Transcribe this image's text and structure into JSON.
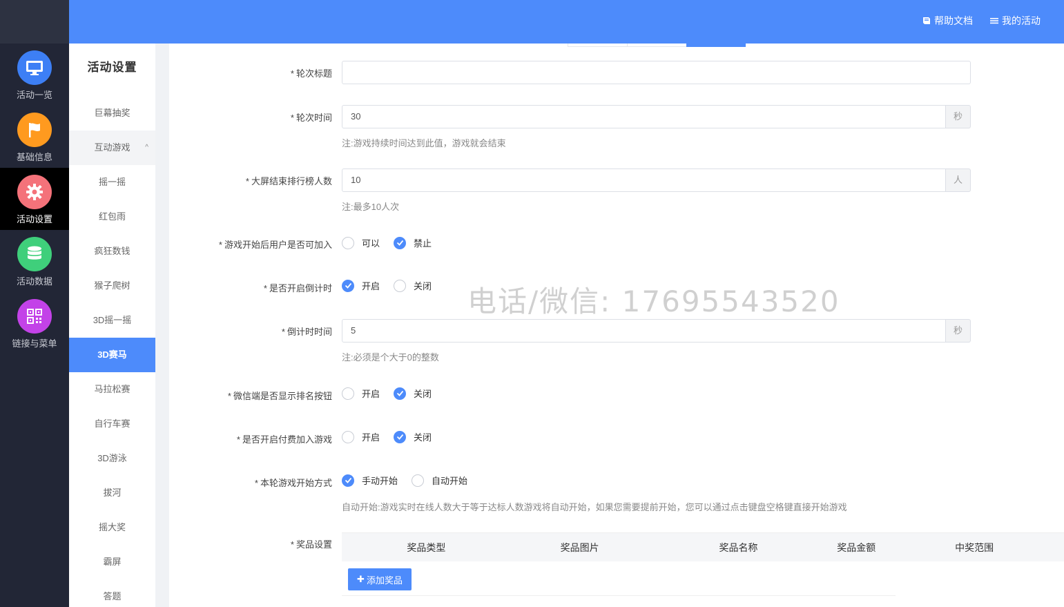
{
  "rail": {
    "items": [
      {
        "label": "活动一览",
        "icon": "monitor-icon",
        "color": "#3d7ff5"
      },
      {
        "label": "基础信息",
        "icon": "flag-icon",
        "color": "#ff9a1f"
      },
      {
        "label": "活动设置",
        "icon": "gear-icon",
        "color": "#f4727a"
      },
      {
        "label": "活动数据",
        "icon": "database-icon",
        "color": "#3fcf7b"
      },
      {
        "label": "链接与菜单",
        "icon": "qrcode-icon",
        "color": "#c342e8"
      }
    ],
    "active_index": 2
  },
  "header": {
    "help_label": "帮助文档",
    "help_icon": "book-icon",
    "activity_label": "我的活动",
    "activity_icon": "list-icon",
    "background": "#4d8bfb"
  },
  "submenu": {
    "title": "活动设置",
    "items": [
      "巨幕抽奖",
      "互动游戏",
      "摇一摇",
      "红包雨",
      "疯狂数钱",
      "猴子爬树",
      "3D摇一摇",
      "3D赛马",
      "马拉松赛",
      "自行车赛",
      "3D游泳",
      "拔河",
      "摇大奖",
      "霸屏",
      "答题"
    ],
    "group_caret": "^",
    "active_item": "3D赛马"
  },
  "form": {
    "round_title": {
      "label": "轮次标题",
      "value": ""
    },
    "round_time": {
      "label": "轮次时间",
      "value": "30",
      "unit": "秒",
      "hint": "注:游戏持续时间达到此值，游戏就会结束"
    },
    "rank_count": {
      "label": "大屏结束排行榜人数",
      "value": "10",
      "unit": "人",
      "hint": "注:最多10人次"
    },
    "join_after_start": {
      "label": "游戏开始后用户是否可加入",
      "options": [
        "可以",
        "禁止"
      ],
      "selected": "禁止"
    },
    "countdown_enabled": {
      "label": "是否开启倒计时",
      "options": [
        "开启",
        "关闭"
      ],
      "selected": "开启"
    },
    "countdown_time": {
      "label": "倒计时时间",
      "value": "5",
      "unit": "秒",
      "hint": "注:必须是个大于0的整数"
    },
    "show_rank_button": {
      "label": "微信端是否显示排名按钮",
      "options": [
        "开启",
        "关闭"
      ],
      "selected": "关闭"
    },
    "paid_join": {
      "label": "是否开启付费加入游戏",
      "options": [
        "开启",
        "关闭"
      ],
      "selected": "关闭"
    },
    "start_mode": {
      "label": "本轮游戏开始方式",
      "options": [
        "手动开始",
        "自动开始"
      ],
      "selected": "手动开始",
      "hint": "自动开始:游戏实时在线人数大于等于达标人数游戏将自动开始，如果您需要提前开始，您可以通过点击键盘空格键直接开始游戏"
    },
    "prizes": {
      "label": "奖品设置",
      "columns": [
        "奖品类型",
        "奖品图片",
        "奖品名称",
        "奖品金额",
        "中奖范围"
      ],
      "add_button": "添加奖品"
    }
  },
  "watermark": "电话/微信: 17695543520"
}
